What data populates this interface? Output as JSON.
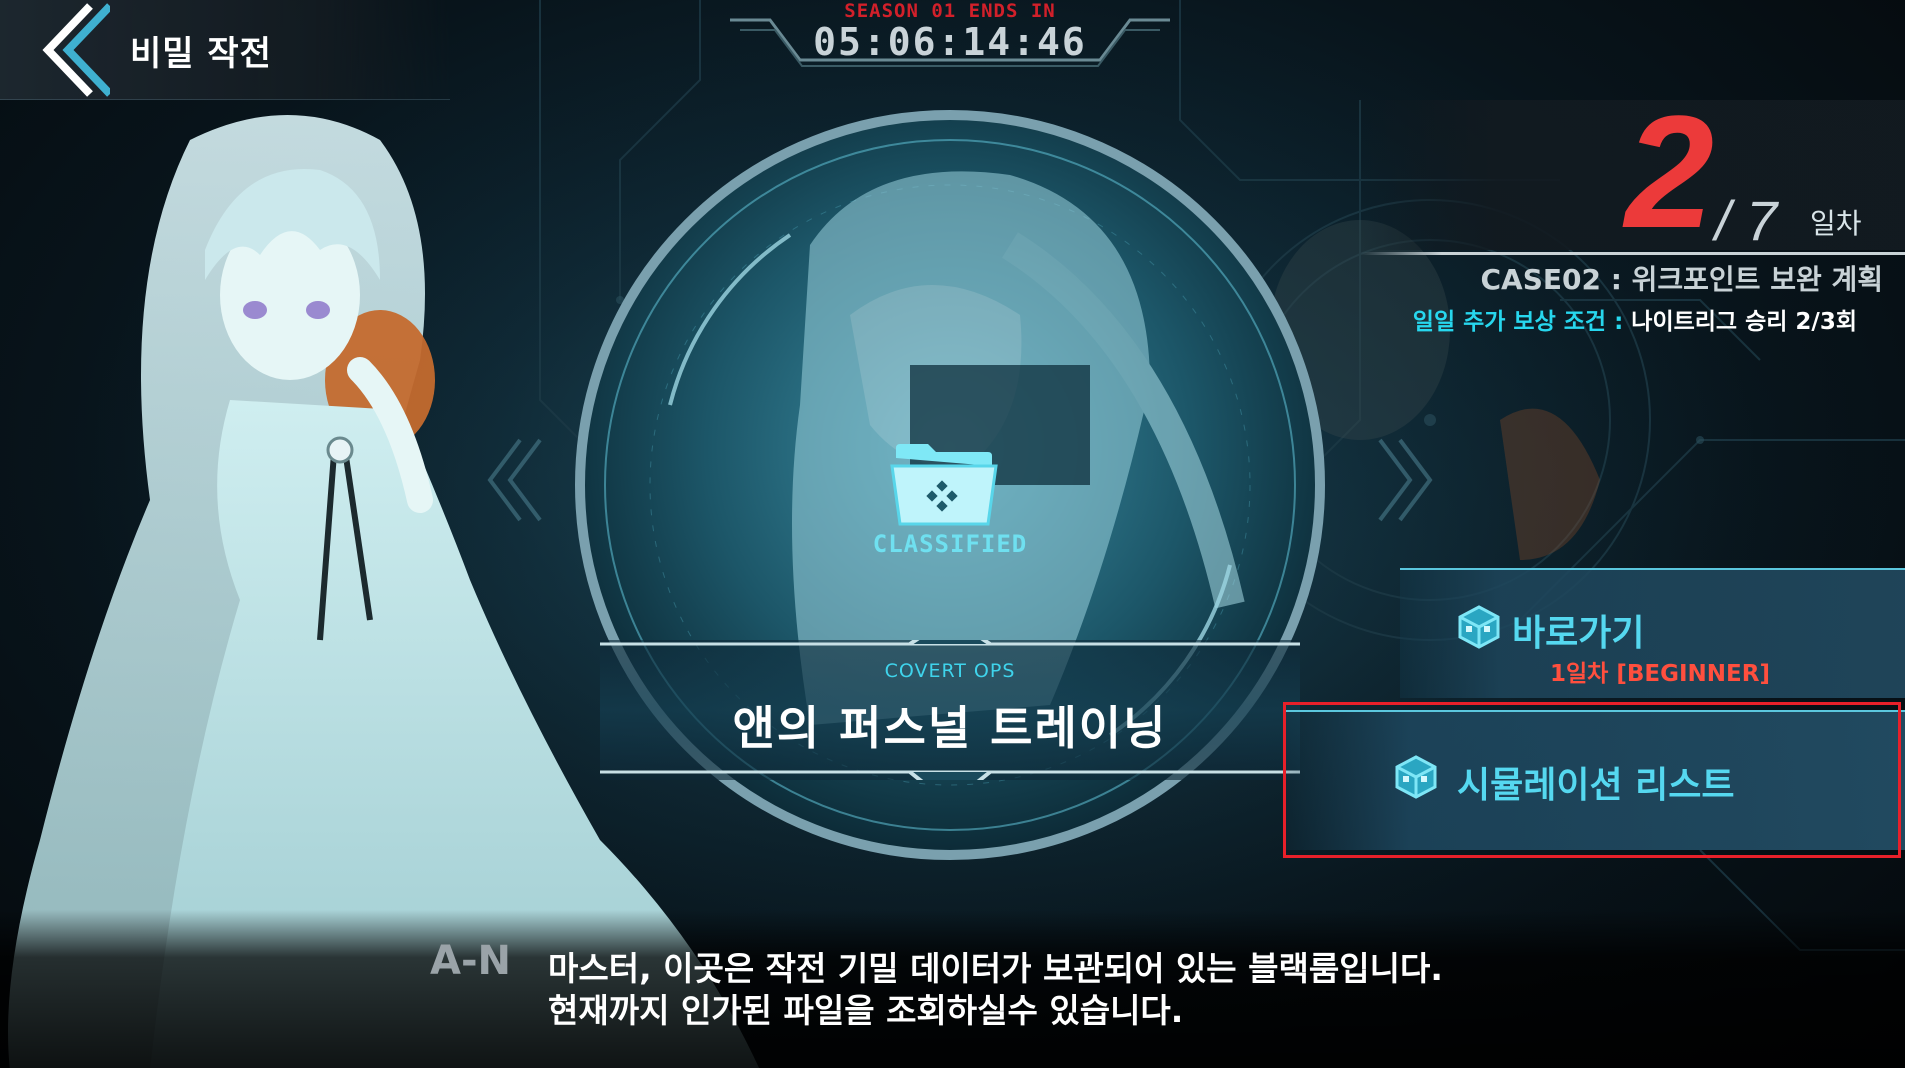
{
  "header": {
    "title": "비밀 작전",
    "back_icon": "chevron-left-icon"
  },
  "season": {
    "label": "SEASON 01 ENDS IN",
    "timer": "05:06:14:46",
    "label_color": "#d2202a"
  },
  "progress": {
    "current_day": "2",
    "total_days": "/ 7",
    "unit": "일차",
    "case_title": "CASE02 : 위크포인트 보완 계획",
    "reward_label": "일일 추가 보상 조건 : ",
    "reward_value": "나이트리그 승리 2/3회",
    "accent_color": "#ec3a3a"
  },
  "operation": {
    "classified_label": "CLASSIFIED",
    "subtitle": "COVERT OPS",
    "title": "앤의 퍼스널 트레이닝",
    "folder_icon": "folder-icon"
  },
  "actions": {
    "shortcut": {
      "label": "바로가기",
      "sub": "1일차 [BEGINNER]",
      "icon": "cube-icon"
    },
    "simulation": {
      "label": "시뮬레이션 리스트",
      "icon": "cube-icon"
    }
  },
  "dialogue": {
    "speaker": "A-N",
    "line1": "마스터, 이곳은 작전 기밀 데이터가 보관되어 있는 블랙룸입니다.",
    "line2": "현재까지 인가된 파일을 조회하실수 있습니다."
  }
}
